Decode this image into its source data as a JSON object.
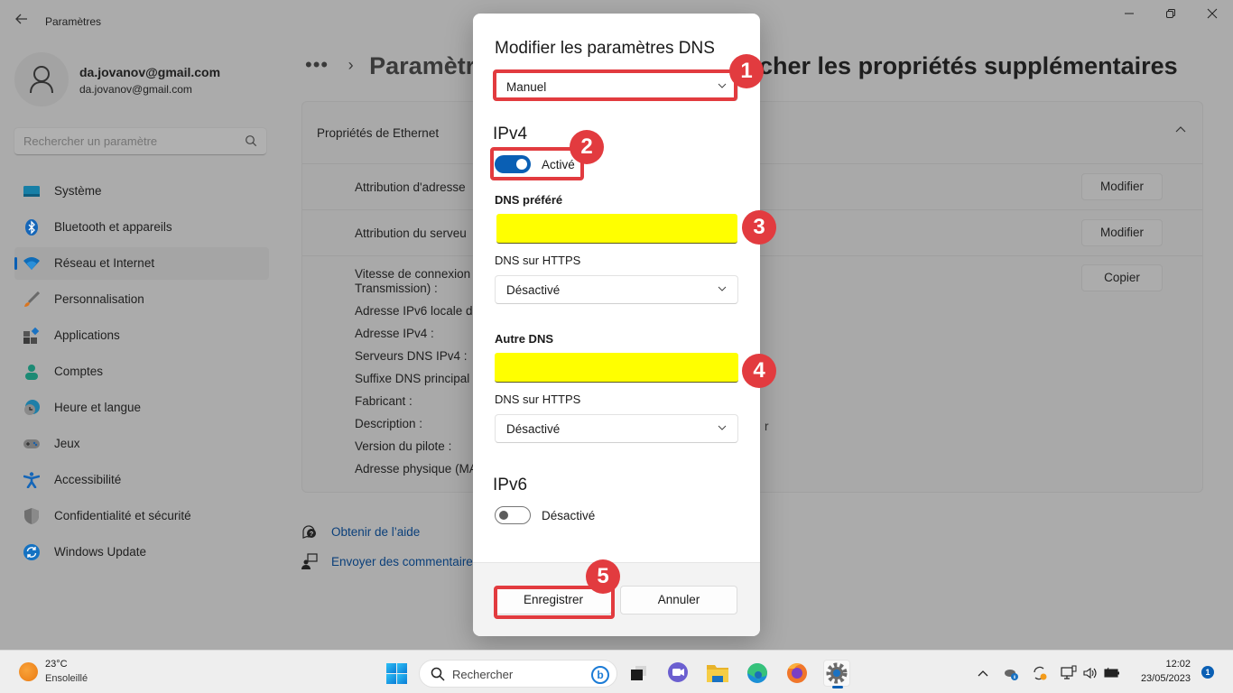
{
  "window": {
    "title": "Paramètres",
    "controls": {
      "minimize": "—",
      "maximize": "❐",
      "close": "✕"
    }
  },
  "profile": {
    "name": "da.jovanov@gmail.com",
    "email": "da.jovanov@gmail.com"
  },
  "search": {
    "placeholder": "Rechercher un paramètre"
  },
  "sidebar": {
    "items": [
      {
        "label": "Système",
        "icon": "system-icon",
        "active": false
      },
      {
        "label": "Bluetooth et appareils",
        "icon": "bluetooth-icon",
        "active": false
      },
      {
        "label": "Réseau et Internet",
        "icon": "wifi-icon",
        "active": true
      },
      {
        "label": "Personnalisation",
        "icon": "brush-icon",
        "active": false
      },
      {
        "label": "Applications",
        "icon": "apps-icon",
        "active": false
      },
      {
        "label": "Comptes",
        "icon": "account-icon",
        "active": false
      },
      {
        "label": "Heure et langue",
        "icon": "clock-globe-icon",
        "active": false
      },
      {
        "label": "Jeux",
        "icon": "gamepad-icon",
        "active": false
      },
      {
        "label": "Accessibilité",
        "icon": "accessibility-icon",
        "active": false
      },
      {
        "label": "Confidentialité et sécurité",
        "icon": "shield-icon",
        "active": false
      },
      {
        "label": "Windows Update",
        "icon": "update-icon",
        "active": false
      }
    ]
  },
  "breadcrumb": {
    "dots": "•••",
    "separator": "›",
    "parent": "Paramètr",
    "current": "cher les propriétés supplémentaires"
  },
  "card": {
    "title": "Propriétés de Ethernet",
    "rows": [
      {
        "label": "Attribution d'adresse",
        "button": "Modifier"
      },
      {
        "label": "Attribution du serveu",
        "button": "Modifier"
      }
    ],
    "copy_button": "Copier",
    "properties": [
      "Vitesse de connexion",
      "Transmission) :",
      "Adresse IPv6 locale d",
      "Adresse IPv4 :",
      "Serveurs DNS IPv4 :",
      "Suffixe DNS principal",
      "Fabricant :",
      "Description :",
      "Version du pilote :",
      "Adresse physique (MA"
    ],
    "partial_value": "r"
  },
  "help": {
    "get_help": "Obtenir de l’aide",
    "feedback": "Envoyer des commentaire"
  },
  "dialog": {
    "title": "Modifier les paramètres DNS",
    "mode": "Manuel",
    "ipv4": {
      "heading": "IPv4",
      "toggle_on": true,
      "toggle_label": "Activé",
      "preferred_dns_label": "DNS préféré",
      "preferred_dns_value": "",
      "preferred_doh_label": "DNS sur HTTPS",
      "preferred_doh_value": "Désactivé",
      "alternate_dns_label": "Autre DNS",
      "alternate_dns_value": "",
      "alternate_doh_label": "DNS sur HTTPS",
      "alternate_doh_value": "Désactivé"
    },
    "ipv6": {
      "heading": "IPv6",
      "toggle_on": false,
      "toggle_label": "Désactivé"
    },
    "save": "Enregistrer",
    "cancel": "Annuler"
  },
  "annotations": {
    "color": "#e23b3f",
    "badges": [
      "1",
      "2",
      "3",
      "4",
      "5"
    ],
    "highlight_color": "#ffff00"
  },
  "taskbar": {
    "weather": {
      "temp": "23°C",
      "desc": "Ensoleillé"
    },
    "search_label": "Rechercher",
    "apps": [
      "task-view-icon",
      "teams-chat-icon",
      "file-explorer-icon",
      "edge-icon",
      "firefox-icon",
      "settings-icon"
    ],
    "tray": {
      "chevron": "^",
      "volume": "🔊"
    },
    "time": "12:02",
    "date": "23/05/2023",
    "notifications": "1"
  }
}
